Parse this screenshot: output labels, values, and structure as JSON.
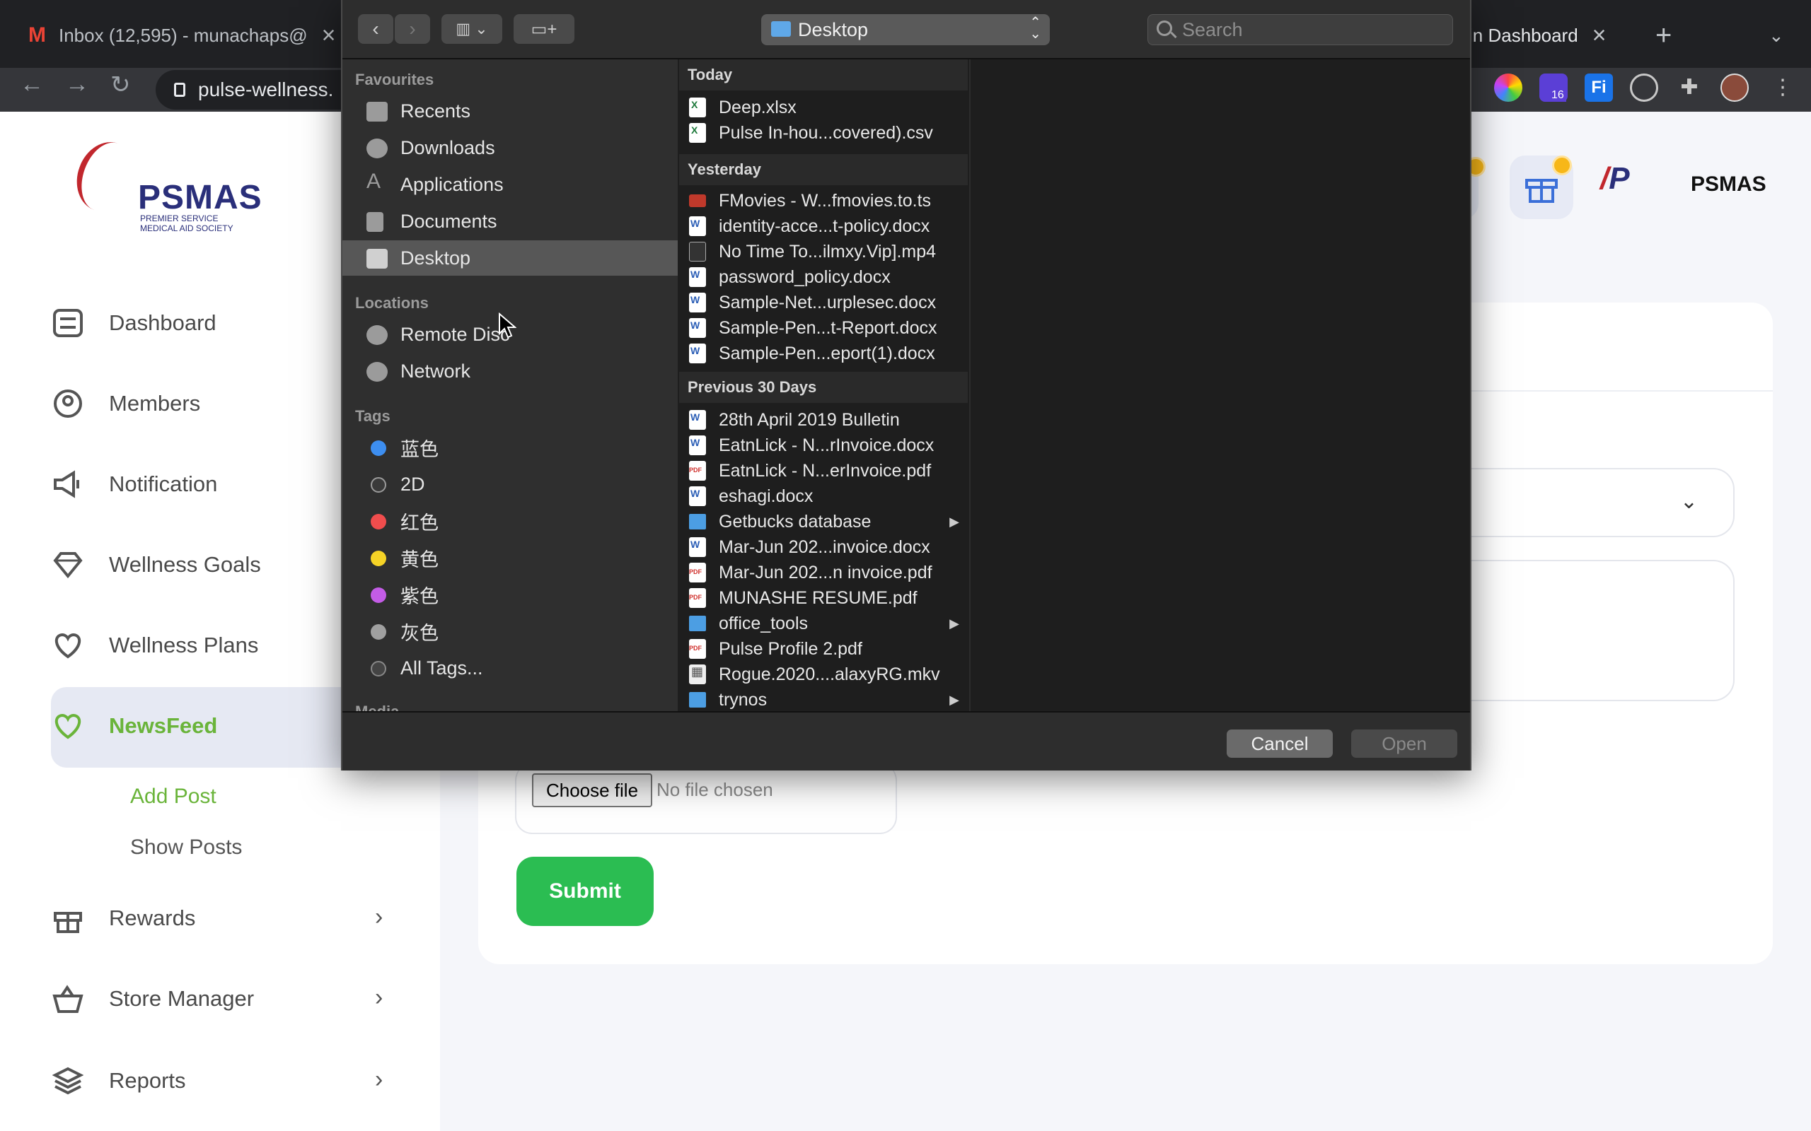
{
  "browser": {
    "tab_left": "Inbox (12,595) - munachaps@",
    "tab_right": "in Dashboard",
    "url": "pulse-wellness.",
    "ext_badge": "16"
  },
  "app": {
    "logo_text": "PSMAS",
    "logo_sub": "PREMIER SERVICE MEDICAL AID SOCIETY",
    "header_name": "PSMAS",
    "sidebar": {
      "items": [
        {
          "label": "Dashboard",
          "icon": "dashboard-icon"
        },
        {
          "label": "Members",
          "icon": "members-icon"
        },
        {
          "label": "Notification",
          "icon": "megaphone-icon"
        },
        {
          "label": "Wellness Goals",
          "icon": "diamond-icon"
        },
        {
          "label": "Wellness Plans",
          "icon": "heart-icon"
        },
        {
          "label": "NewsFeed",
          "icon": "heart-icon"
        },
        {
          "label": "Rewards",
          "icon": "gift-icon"
        },
        {
          "label": "Store Manager",
          "icon": "basket-icon"
        },
        {
          "label": "Reports",
          "icon": "layers-icon"
        }
      ],
      "sub_items": [
        {
          "label": "Add Post"
        },
        {
          "label": "Show Posts"
        }
      ]
    },
    "form": {
      "choose_file": "Choose file",
      "no_file": "No file chosen",
      "submit": "Submit"
    },
    "colors": {
      "accent_green": "#2bbd52",
      "active_nav_text": "#6ab43a",
      "brand_navy": "#2a2f7a"
    }
  },
  "dialog": {
    "location": "Desktop",
    "search_placeholder": "Search",
    "sidebar": {
      "favourites_header": "Favourites",
      "favourites": [
        "Recents",
        "Downloads",
        "Applications",
        "Documents",
        "Desktop"
      ],
      "locations_header": "Locations",
      "locations": [
        "Remote Disc",
        "Network"
      ],
      "tags_header": "Tags",
      "tags": [
        {
          "label": "蓝色",
          "color": "#3d8ef0"
        },
        {
          "label": "2D",
          "color": "#3a3a3a"
        },
        {
          "label": "红色",
          "color": "#f04d4d"
        },
        {
          "label": "黄色",
          "color": "#f5d326"
        },
        {
          "label": "紫色",
          "color": "#c35ce6"
        },
        {
          "label": "灰色",
          "color": "#a0a0a0"
        },
        {
          "label": "All Tags...",
          "color": "#444444"
        }
      ],
      "media_header": "Media"
    },
    "sections": [
      {
        "header": "Today",
        "files": [
          {
            "name": "Deep.xlsx",
            "type": "xls"
          },
          {
            "name": "Pulse In-hou...covered).csv",
            "type": "xls"
          }
        ]
      },
      {
        "header": "Yesterday",
        "files": [
          {
            "name": "FMovies - W...fmovies.to.ts",
            "type": "ts"
          },
          {
            "name": "identity-acce...t-policy.docx",
            "type": "word"
          },
          {
            "name": "No Time To...ilmxy.Vip].mp4",
            "type": "video"
          },
          {
            "name": "password_policy.docx",
            "type": "word"
          },
          {
            "name": "Sample-Net...urplesec.docx",
            "type": "word"
          },
          {
            "name": "Sample-Pen...t-Report.docx",
            "type": "word"
          },
          {
            "name": "Sample-Pen...eport(1).docx",
            "type": "word"
          }
        ]
      },
      {
        "header": "Previous 30 Days",
        "files": [
          {
            "name": "28th April 2019 Bulletin",
            "type": "word"
          },
          {
            "name": "EatnLick - N...rInvoice.docx",
            "type": "word"
          },
          {
            "name": "EatnLick - N...erInvoice.pdf",
            "type": "pdf"
          },
          {
            "name": "eshagi.docx",
            "type": "word"
          },
          {
            "name": "Getbucks database",
            "type": "folder",
            "expandable": true
          },
          {
            "name": "Mar-Jun 202...invoice.docx",
            "type": "word"
          },
          {
            "name": "Mar-Jun 202...n invoice.pdf",
            "type": "pdf"
          },
          {
            "name": "MUNASHE RESUME.pdf",
            "type": "pdf"
          },
          {
            "name": "office_tools",
            "type": "folder",
            "expandable": true
          },
          {
            "name": "Pulse Profile 2.pdf",
            "type": "pdf"
          },
          {
            "name": "Rogue.2020....alaxyRG.mkv",
            "type": "mkv"
          },
          {
            "name": "trynos",
            "type": "folder",
            "expandable": true
          }
        ]
      }
    ],
    "cancel": "Cancel",
    "open": "Open"
  }
}
